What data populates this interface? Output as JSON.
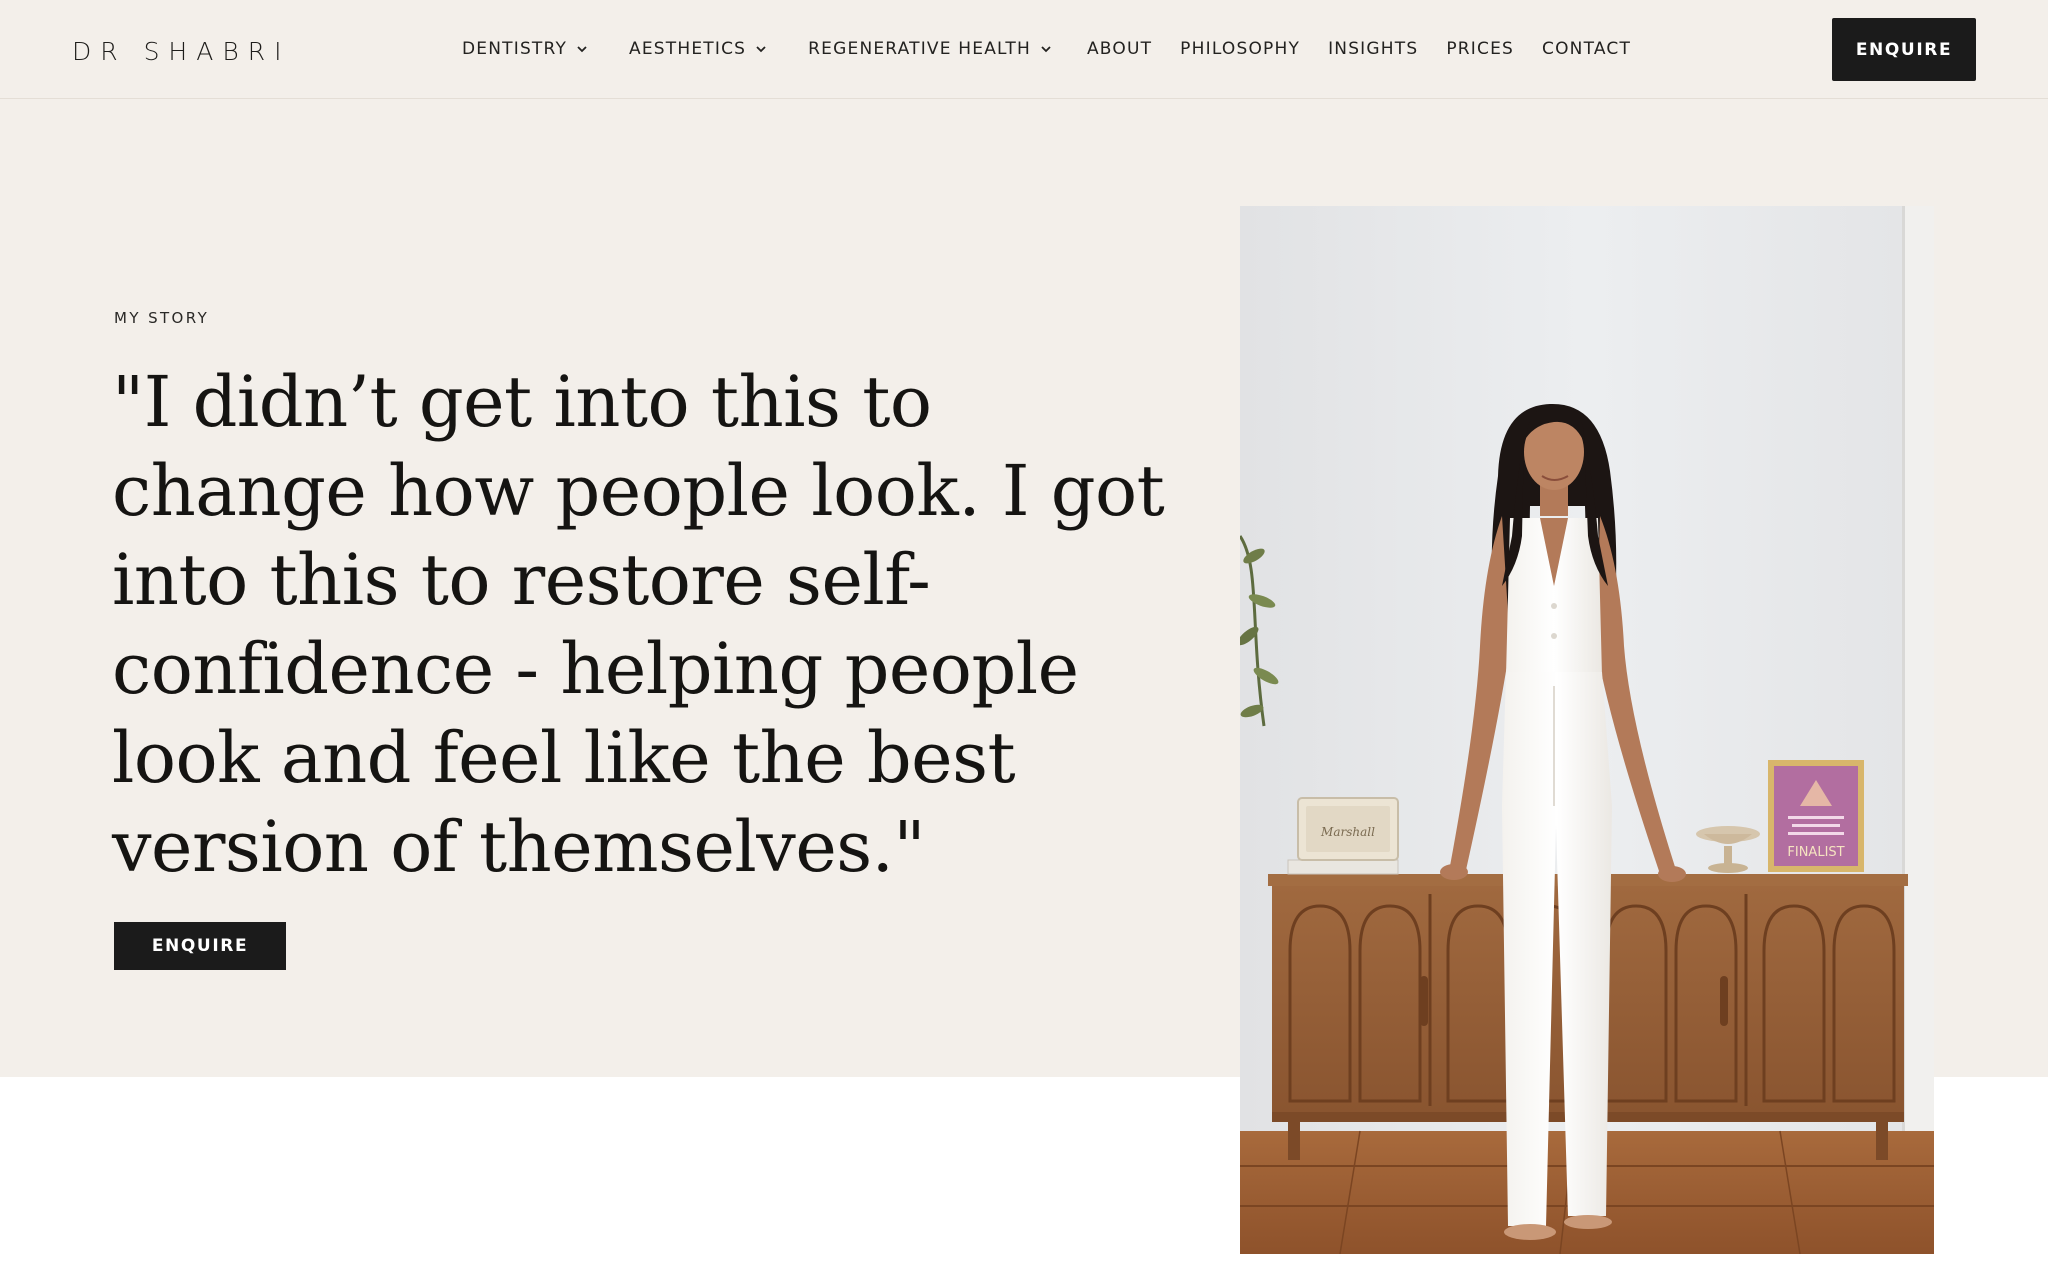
{
  "brand": {
    "logo_text": "DR SHABRI"
  },
  "nav": {
    "items": [
      {
        "label": "DENTISTRY",
        "has_dropdown": true
      },
      {
        "label": "AESTHETICS",
        "has_dropdown": true
      },
      {
        "label": "REGENERATIVE HEALTH",
        "has_dropdown": true
      },
      {
        "label": "ABOUT",
        "has_dropdown": false
      },
      {
        "label": "PHILOSOPHY",
        "has_dropdown": false
      },
      {
        "label": "INSIGHTS",
        "has_dropdown": false
      },
      {
        "label": "PRICES",
        "has_dropdown": false
      },
      {
        "label": "CONTACT",
        "has_dropdown": false
      }
    ],
    "cta_label": "ENQUIRE"
  },
  "hero": {
    "eyebrow": "MY STORY",
    "quote": "\"I didn’t get into this to change how people look. I got into this to restore self-confidence - helping people look and feel like the best version of themselves.\"",
    "cta_label": "ENQUIRE",
    "image": {
      "speaker_brand": "Marshall",
      "award_text": "FINALIST"
    }
  },
  "colors": {
    "page_bg": "#ffffff",
    "band_bg": "#f3efea",
    "button_bg": "#1b1b1b",
    "button_text": "#ffffff",
    "text": "#151412"
  },
  "icons": {
    "dropdown": "chevron-down-icon"
  }
}
